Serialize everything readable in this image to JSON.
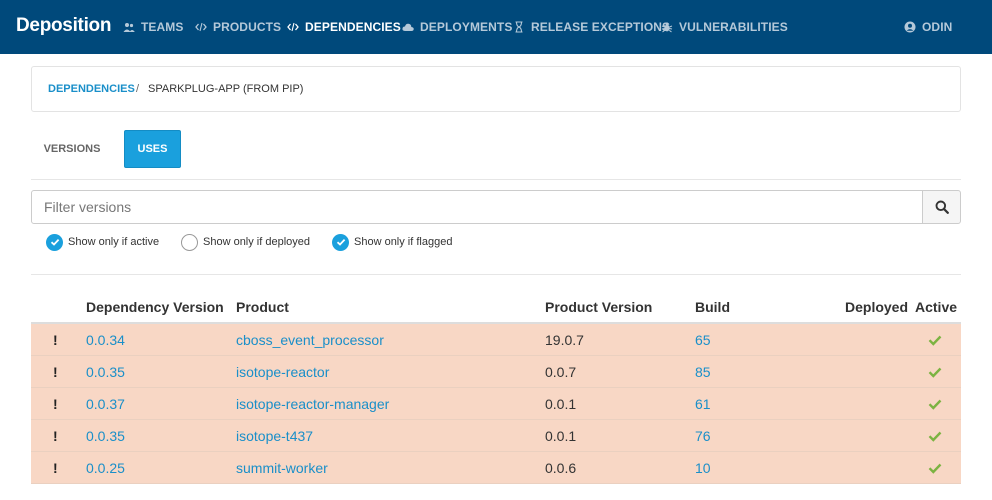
{
  "navbar": {
    "brand": "Deposition",
    "items": [
      {
        "label": "TEAMS",
        "icon": "users-icon",
        "active": false
      },
      {
        "label": "PRODUCTS",
        "icon": "code-icon",
        "active": false
      },
      {
        "label": "DEPENDENCIES",
        "icon": "code-icon",
        "active": true
      },
      {
        "label": "DEPLOYMENTS",
        "icon": "cloud-icon",
        "active": false
      },
      {
        "label": "RELEASE EXCEPTIONS",
        "icon": "hourglass-icon",
        "active": false
      },
      {
        "label": "VULNERABILITIES",
        "icon": "bug-icon",
        "active": false
      }
    ],
    "user": {
      "label": "ODIN",
      "icon": "user-circle-icon"
    }
  },
  "breadcrumb": {
    "link": "DEPENDENCIES",
    "separator": "/",
    "current": "SPARKPLUG-APP (FROM PIP)"
  },
  "tabs": [
    {
      "label": "VERSIONS",
      "active": false
    },
    {
      "label": "USES",
      "active": true
    }
  ],
  "filter": {
    "placeholder": "Filter versions",
    "value": "",
    "search_icon": "search-icon"
  },
  "checkboxes": [
    {
      "label": "Show only if active",
      "checked": true
    },
    {
      "label": "Show only if deployed",
      "checked": false
    },
    {
      "label": "Show only if flagged",
      "checked": true
    }
  ],
  "table": {
    "headers": {
      "dependency_version": "Dependency Version",
      "product": "Product",
      "product_version": "Product Version",
      "build": "Build",
      "deployed": "Deployed",
      "active": "Active"
    },
    "rows": [
      {
        "flag": "!",
        "dependency_version": "0.0.34",
        "product": "cboss_event_processor",
        "product_version": "19.0.7",
        "build": "65",
        "deployed": "",
        "active": true
      },
      {
        "flag": "!",
        "dependency_version": "0.0.35",
        "product": "isotope-reactor",
        "product_version": "0.0.7",
        "build": "85",
        "deployed": "",
        "active": true
      },
      {
        "flag": "!",
        "dependency_version": "0.0.37",
        "product": "isotope-reactor-manager",
        "product_version": "0.0.1",
        "build": "61",
        "deployed": "",
        "active": true
      },
      {
        "flag": "!",
        "dependency_version": "0.0.35",
        "product": "isotope-t437",
        "product_version": "0.0.1",
        "build": "76",
        "deployed": "",
        "active": true
      },
      {
        "flag": "!",
        "dependency_version": "0.0.25",
        "product": "summit-worker",
        "product_version": "0.0.6",
        "build": "10",
        "deployed": "",
        "active": true
      }
    ],
    "active_icon": "check-icon"
  },
  "colors": {
    "navbar": "#00497b",
    "accent": "#1aa0dd",
    "link": "#1a8fc9",
    "flagged_row": "#f8d7c5",
    "check": "#7cb342"
  }
}
